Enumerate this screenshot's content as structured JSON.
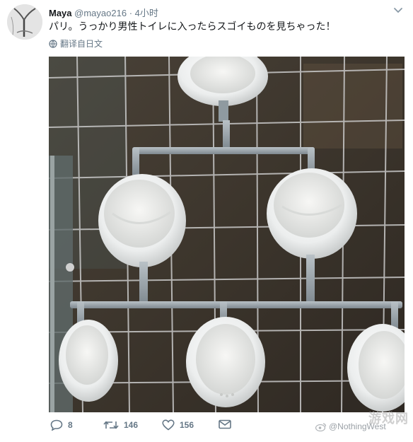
{
  "tweet": {
    "name": "Maya",
    "handle": "@mayao216",
    "separator": "·",
    "time": "4小时",
    "text": "パリ。うっかり男性トイレに入ったらスゴイものを見ちゃった！",
    "translate_label": "翻译自日文",
    "replies": "8",
    "retweets": "146",
    "likes": "156"
  },
  "watermark": {
    "handle": "@NothingWest",
    "logo": "游戏网"
  },
  "icons": {
    "avatar": "avatar-sketch",
    "chevron": "chevron-down-icon",
    "globe": "globe-icon",
    "reply": "reply-icon",
    "retweet": "retweet-icon",
    "like": "heart-icon",
    "dm": "envelope-icon",
    "weibo": "weibo-icon"
  },
  "colors": {
    "text_primary": "#14171a",
    "text_secondary": "#657786",
    "icon_gray": "#657786",
    "wall_tile": "#3a342d",
    "grout": "#c9c9c9",
    "pipe": "#9aa4ab",
    "porcelain": "#f4f4f2"
  }
}
